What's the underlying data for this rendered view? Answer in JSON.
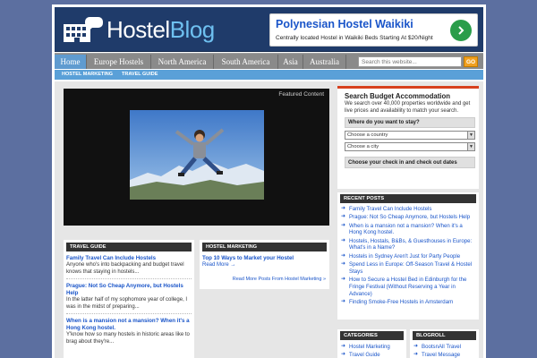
{
  "header": {
    "logo_text_a": "Hostel",
    "logo_text_b": "Blog",
    "ad": {
      "title": "Polynesian Hostel Waikiki",
      "description": "Centrally located Hostel in Waikiki Beds Starting At $20/Night"
    }
  },
  "nav": {
    "items": [
      "Home",
      "Europe Hostels",
      "North America",
      "South America",
      "Asia",
      "Australia"
    ],
    "search_placeholder": "Search this website...",
    "search_button": "GO"
  },
  "subnav": {
    "items": [
      "Hostel Marketing",
      "Travel Guide"
    ]
  },
  "featured": {
    "label": "Featured Content"
  },
  "travel_guide": {
    "heading": "Travel Guide",
    "posts": [
      {
        "title": "Family Travel Can Include Hostels",
        "excerpt": "Anyone who's into backpacking and budget travel knows that staying in hostels..."
      },
      {
        "title": "Prague: Not So Cheap Anymore, but Hostels Help",
        "excerpt": "In the latter half of my sophomore year of college, I was in the midst of preparing..."
      },
      {
        "title": "When is a mansion not a mansion? When it's a Hong Kong hostel.",
        "excerpt": "Y'know how so many hostels in historic areas like to brag about they're..."
      }
    ]
  },
  "hostel_marketing": {
    "heading": "Hostel Marketing",
    "post_title": "Top 10 Ways to Market your Hostel",
    "read_more": "Read More →",
    "more_posts": "Read More Posts From Hostel Marketing »"
  },
  "booking": {
    "title": "Search Budget Accommodation",
    "description": "We search over 40,000 properties worldwide and get live prices and availability to match your search.",
    "where_label": "Where do you want to stay?",
    "country_select": "Choose a country",
    "city_select": "Choose a city",
    "dates_label": "Choose your check in and check out dates"
  },
  "recent_posts": {
    "heading": "Recent Posts",
    "items": [
      "Family Travel Can Include Hostels",
      "Prague: Not So Cheap Anymore, but Hostels Help",
      "When is a mansion not a mansion? When it's a Hong Kong hostel.",
      "Hostels, Hostals, B&Bs, & Guesthouses in Europe: What's in a Name?",
      "Hostels in Sydney Aren't Just for Party People",
      "Spend Less in Europe: Off-Season Travel & Hostel Stays",
      "How to Secure a Hostel Bed in Edinburgh for the Fringe Festival (Without Reserving a Year in Advance)",
      "Finding Smoke-Free Hostels in Amsterdam"
    ]
  },
  "categories": {
    "heading": "Categories",
    "items": [
      "Hostel Marketing",
      "Travel Guide"
    ]
  },
  "blogroll": {
    "heading": "Blogroll",
    "items": [
      "BootsnAll Travel",
      "Travel Message"
    ]
  },
  "colors": {
    "page_bg": "#5c6fa0",
    "header_bg": "#1f3b6a",
    "nav_bg": "#8a8a8a",
    "nav_active": "#5f9bd0",
    "subnav_bg": "#5aa0d8",
    "link": "#1a55c9",
    "accent": "#d7401e"
  },
  "icons": {
    "logo": "hostel-building-icon",
    "ad_button": "chevron-right-icon",
    "list_bullet": "arrow-right-icon",
    "select": "dropdown-arrow-icon"
  }
}
